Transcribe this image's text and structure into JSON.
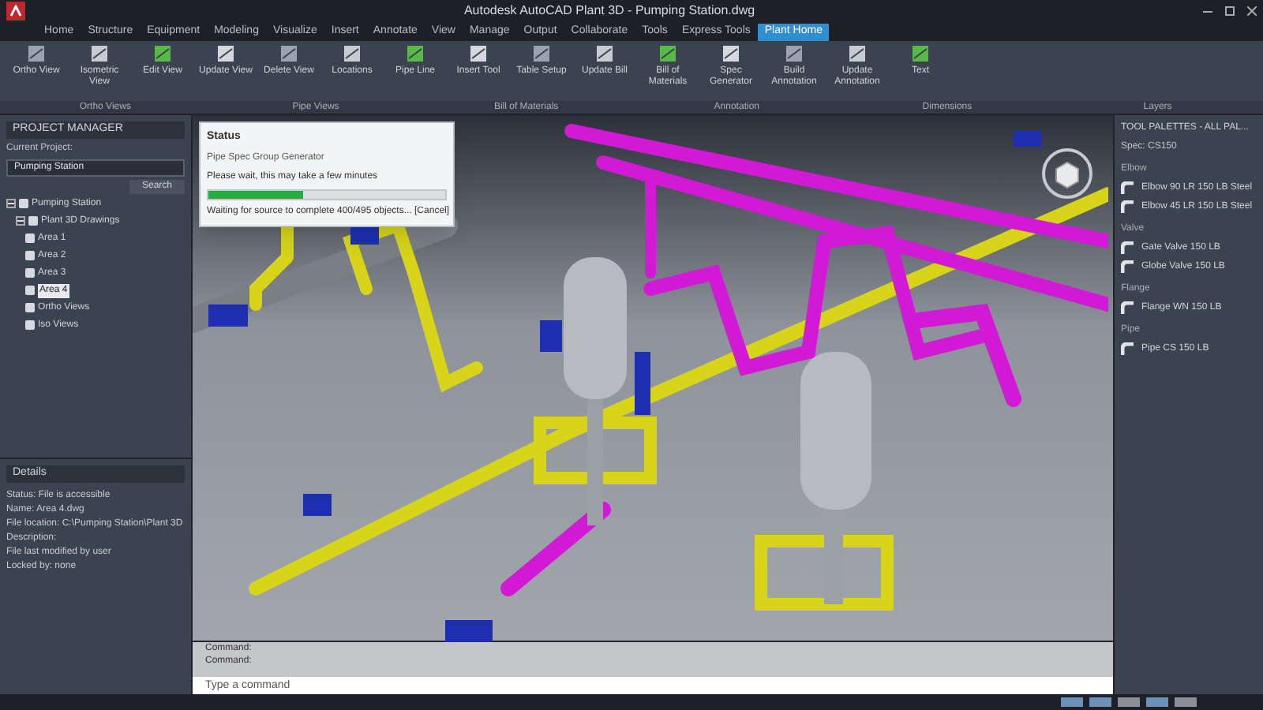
{
  "window": {
    "title": "Autodesk AutoCAD Plant 3D - Pumping Station.dwg"
  },
  "ribbon_tabs": [
    {
      "label": "Home",
      "selected": false
    },
    {
      "label": "Structure",
      "selected": false
    },
    {
      "label": "Equipment",
      "selected": false
    },
    {
      "label": "Modeling",
      "selected": false
    },
    {
      "label": "Visualize",
      "selected": false
    },
    {
      "label": "Insert",
      "selected": false
    },
    {
      "label": "Annotate",
      "selected": false
    },
    {
      "label": "View",
      "selected": false
    },
    {
      "label": "Manage",
      "selected": false
    },
    {
      "label": "Output",
      "selected": false
    },
    {
      "label": "Collaborate",
      "selected": false
    },
    {
      "label": "Tools",
      "selected": false
    },
    {
      "label": "Express Tools",
      "selected": false
    },
    {
      "label": "Plant Home",
      "selected": true
    }
  ],
  "ribbon_buttons": [
    {
      "label": "Ortho View"
    },
    {
      "label": "Isometric View"
    },
    {
      "label": "Edit View"
    },
    {
      "label": "Update View"
    },
    {
      "label": "Delete View"
    },
    {
      "label": "Locations"
    },
    {
      "label": "Pipe Line"
    },
    {
      "label": "Insert Tool"
    },
    {
      "label": "Table Setup"
    },
    {
      "label": "Update Bill"
    },
    {
      "label": "Bill of Materials"
    },
    {
      "label": "Spec Generator"
    },
    {
      "label": "Build Annotation"
    },
    {
      "label": "Update Annotation"
    },
    {
      "label": "Text"
    }
  ],
  "ribbon_panels": [
    {
      "label": "Ortho Views"
    },
    {
      "label": "Pipe Views"
    },
    {
      "label": "Bill of Materials"
    },
    {
      "label": "Annotation"
    },
    {
      "label": "Dimensions"
    },
    {
      "label": "Layers"
    }
  ],
  "project_manager": {
    "title": "PROJECT MANAGER",
    "current_project": "Current Project:",
    "project": "Pumping Station",
    "search": "Search",
    "tree": [
      {
        "label": "Pumping Station",
        "expanded": true,
        "children": [
          {
            "label": "Plant 3D Drawings",
            "expanded": true,
            "children": [
              {
                "label": "Area 1"
              },
              {
                "label": "Area 2"
              },
              {
                "label": "Area 3"
              },
              {
                "label": "Area 4",
                "selected": true
              },
              {
                "label": "Ortho Views"
              },
              {
                "label": "Iso Views"
              }
            ]
          }
        ]
      }
    ]
  },
  "details": {
    "title": "Details",
    "lines": [
      "Status: File is accessible",
      "Name: Area 4.dwg",
      "File location: C:\\Pumping Station\\Plant 3D",
      "Description:",
      "File last modified by user",
      "Locked by: none"
    ]
  },
  "progress_dialog": {
    "title": "Status",
    "heading": "Pipe Spec Group Generator",
    "message": "Please wait, this may take a few minutes",
    "level": 0.4,
    "detail": "Waiting for source to complete 400/495 objects... [Cancel]"
  },
  "tool_palette": {
    "title": "TOOL PALETTES - ALL PAL...",
    "spec": "Spec: CS150",
    "groups": [
      {
        "heading": "Elbow",
        "items": [
          "Elbow 90 LR 150 LB Steel",
          "Elbow 45 LR 150 LB Steel"
        ]
      },
      {
        "heading": "Valve",
        "items": [
          "Gate Valve 150 LB",
          "Globe Valve 150 LB"
        ]
      },
      {
        "heading": "Flange",
        "items": [
          "Flange WN 150 LB"
        ]
      },
      {
        "heading": "Pipe",
        "items": [
          "Pipe CS 150 LB"
        ]
      }
    ]
  },
  "command_line": {
    "history": [
      "Command:",
      "Command:"
    ],
    "placeholder": "Type a command"
  }
}
